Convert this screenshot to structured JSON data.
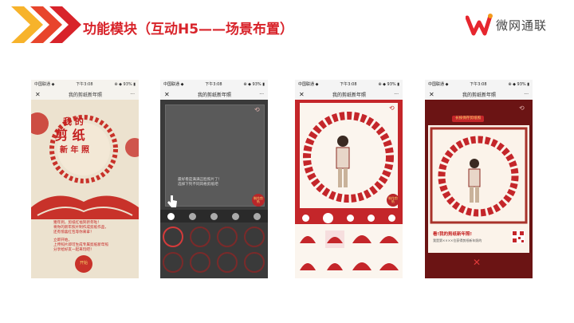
{
  "header": {
    "title": "功能模块（互动H5——场景布置）",
    "brand_name": "微网通联",
    "accent_color": "#d8232a",
    "chevron_colors": [
      "#f7b32b",
      "#e8452c",
      "#d8232a"
    ]
  },
  "screens": [
    {
      "status_left": "中国联通 ◆",
      "status_time": "下午3:08",
      "status_right": "⊕ ◆ 93% ▮",
      "nav_close": "✕",
      "nav_title": "我的剪纸新年照",
      "nav_more": "···",
      "hero_line1": "我 的",
      "hero_line2": "剪 纸",
      "hero_line3": "新 年 照",
      "desc_lines": [
        "猪年到，剪纸红福贺新年啦！",
        "将你的新年照片制作成剪纸作品，",
        "还有惊喜红包等你来拿！"
      ],
      "desc_lines2": [
        "立即开始，",
        "上传照片即可生成专属剪纸新年照",
        "分享给好友一起来玩吧！"
      ],
      "start_badge": "开始"
    },
    {
      "status_left": "中国联通 ◆",
      "status_time": "下午3:08",
      "status_right": "⊕ ◆ 93% ▮",
      "nav_close": "✕",
      "nav_title": "我的剪纸新年照",
      "nav_more": "···",
      "corner_icon": "⟲",
      "tip_line1": "最好看是满满正脸照片了！",
      "tip_line2": "选择下列不同风格剪纸吧",
      "make_button": "制作剪纸"
    },
    {
      "status_left": "中国联通 ◆",
      "status_time": "下午3:08",
      "status_right": "⊕ ◆ 93% ▮",
      "nav_close": "✕",
      "nav_title": "我的剪纸新年照",
      "nav_more": "···",
      "corner_icon": "⟲",
      "make_button": "制作剪纸"
    },
    {
      "status_left": "中国联通 ◆",
      "status_time": "下午3:08",
      "status_right": "⊕ ◆ 93% ▮",
      "nav_close": "✕",
      "nav_title": "我的剪纸新年照",
      "nav_more": "···",
      "banner": "长按保存剪纸照",
      "corner_icon": "⟲",
      "result_title": "看!我的剪纸新年照!",
      "result_sub": "我是第××××位获得剪纸新年照的",
      "close_icon": "✕"
    }
  ]
}
